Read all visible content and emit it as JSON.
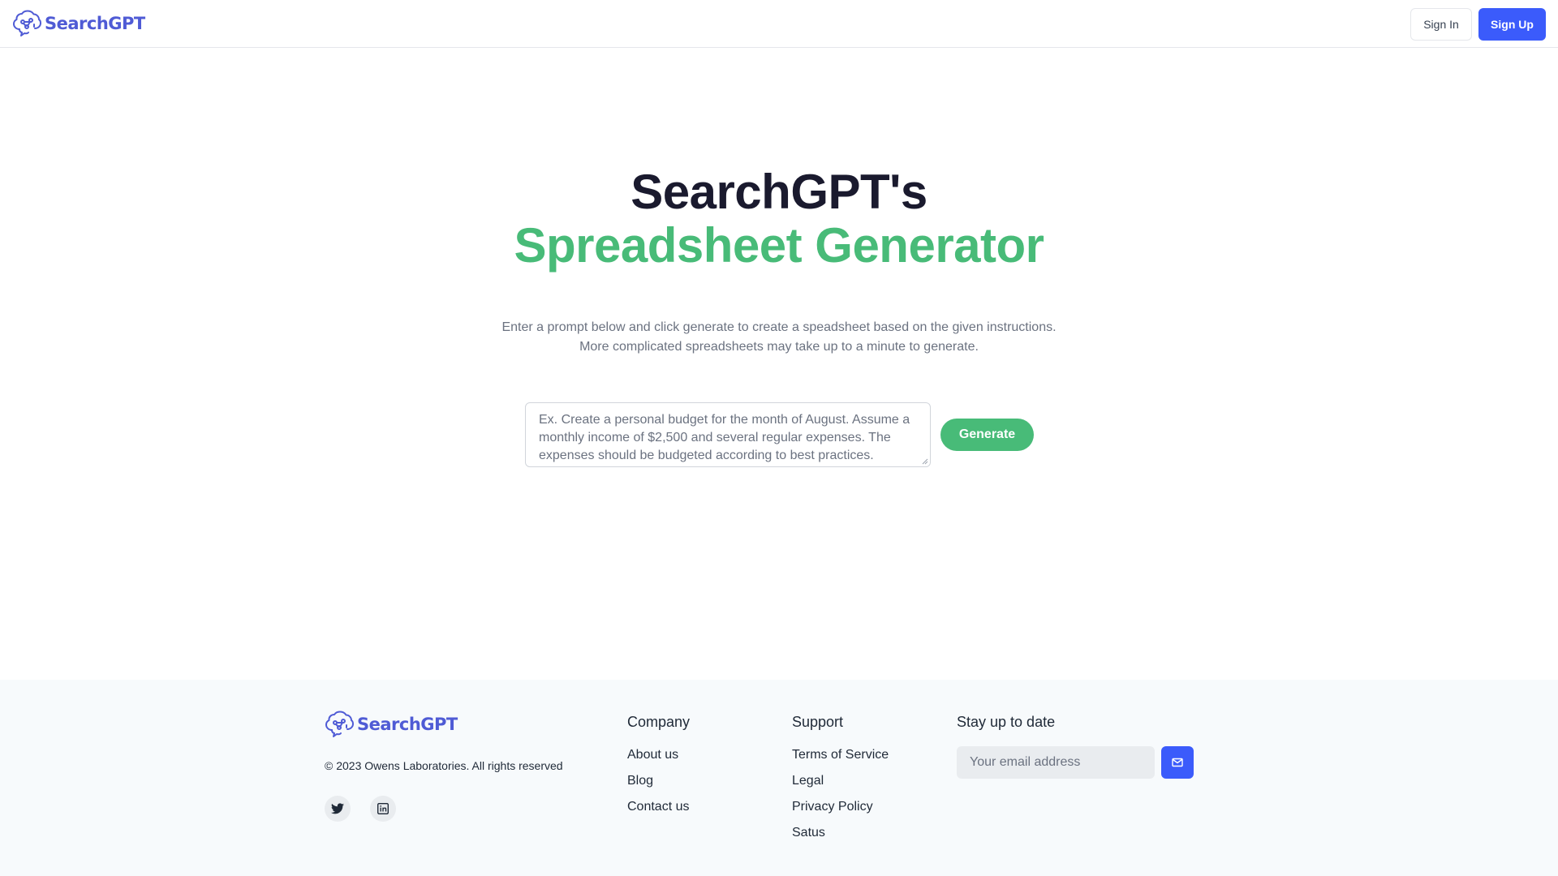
{
  "header": {
    "logo_text": "SearchGPT",
    "sign_in_label": "Sign In",
    "sign_up_label": "Sign Up"
  },
  "hero": {
    "title_line1": "SearchGPT's",
    "title_line2": "Spreadsheet Generator",
    "description": "Enter a prompt below and click generate to create a speadsheet based on the given instructions. More complicated spreadsheets may take up to a minute to generate.",
    "prompt_placeholder": "Ex. Create a personal budget for the month of August. Assume a monthly income of $2,500 and several regular expenses. The expenses should be budgeted according to best practices.",
    "generate_label": "Generate"
  },
  "footer": {
    "logo_text": "SearchGPT",
    "copyright": "© 2023 Owens Laboratories. All rights reserved",
    "social": [
      "twitter-icon",
      "linkedin-icon"
    ],
    "company": {
      "heading": "Company",
      "links": [
        "About us",
        "Blog",
        "Contact us"
      ]
    },
    "support": {
      "heading": "Support",
      "links": [
        "Terms of Service",
        "Legal",
        "Privacy Policy",
        "Satus"
      ]
    },
    "newsletter": {
      "heading": "Stay up to date",
      "email_placeholder": "Your email address"
    }
  },
  "colors": {
    "brand_blue": "#3b5bfb",
    "logo_blue": "#4f5bd5",
    "accent_green": "#48bb78"
  }
}
